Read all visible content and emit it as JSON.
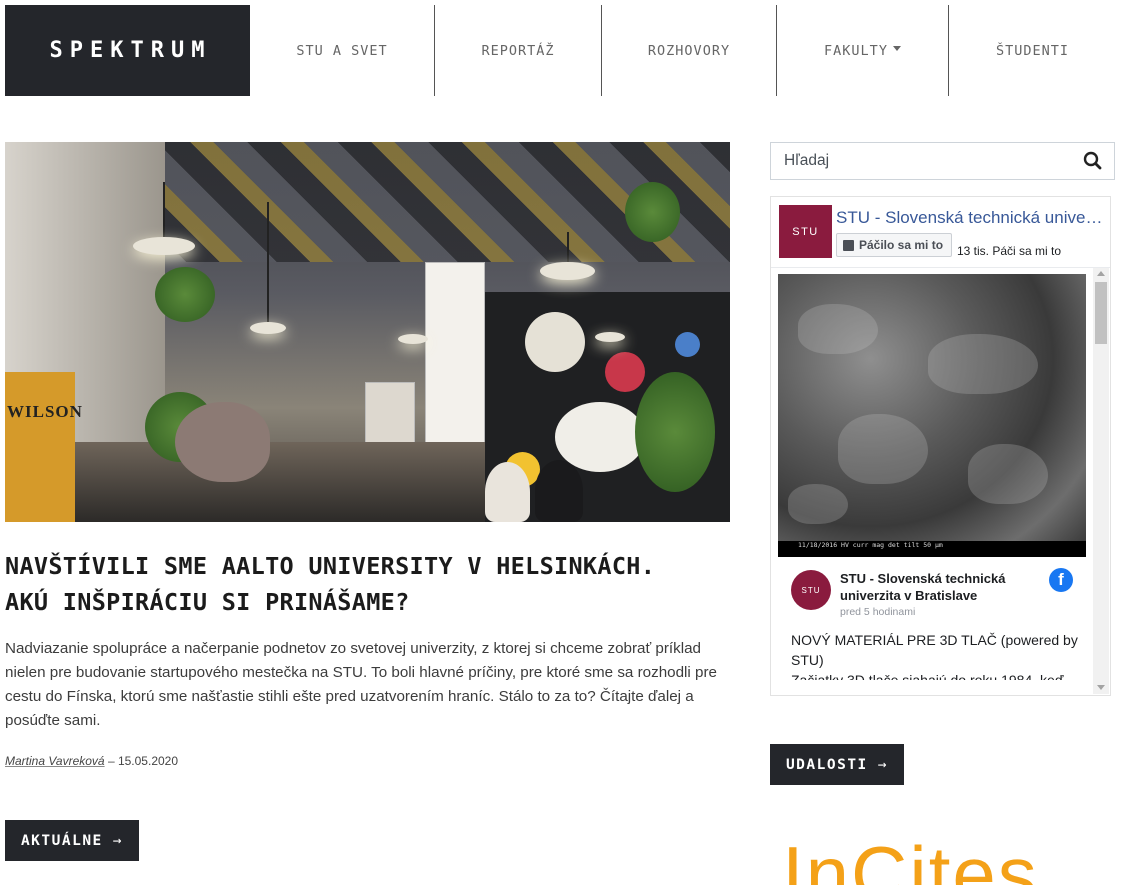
{
  "header": {
    "logo": "SPEKTRUM",
    "nav": [
      {
        "label": "STU A SVET",
        "dropdown": false
      },
      {
        "label": "REPORTÁŽ",
        "dropdown": false
      },
      {
        "label": "ROZHOVORY",
        "dropdown": false
      },
      {
        "label": "FAKULTY",
        "dropdown": true
      },
      {
        "label": "ŠTUDENTI",
        "dropdown": false
      }
    ]
  },
  "article": {
    "title_line1": "NAVŠTÍVILI SME AALTO UNIVERSITY V HELSINKÁCH.",
    "title_line2": "AKÚ INŠPIRÁCIU SI PRINÁŠAME?",
    "excerpt": "Nadviazanie spolupráce a načerpanie podnetov zo svetovej univerzity, z ktorej si chceme zobrať príklad nielen pre budovanie startupového mestečka na STU. To boli hlavné príčiny, pre ktoré sme sa rozhodli pre cestu do Fínska, ktorú sme našťastie stihli ešte pred uzatvorením hraníc. Stálo to za to? Čítajte ďalej a posúďte sami.",
    "author": "Martina Vavreková",
    "separator": " – ",
    "date": "15.05.2020",
    "image_bag_text": "WILSON"
  },
  "buttons": {
    "aktualne": "AKTUÁLNE",
    "udalosti": "UDALOSTI",
    "arrow": "→"
  },
  "search": {
    "placeholder": "Hľadaj"
  },
  "facebook": {
    "page_name": "STU - Slovenská technická univerzita v Bratislave",
    "logo_text": "STU",
    "like_label": "Páčilo sa mi to",
    "like_count": "13 tis. Páči sa mi to",
    "sem_caption": "11/18/2016   HV   curr   mag   det   tilt        50 µm",
    "post": {
      "author": "STU - Slovenská technická univerzita v Bratislave",
      "time": "pred 5 hodinami",
      "text": "NOVÝ MATERIÁL PRE 3D TLAČ (powered by STU)\nZačiatky 3D tlače siahajú do roku 1984, keď Charles W. Hull požiadal o patentovanie"
    }
  },
  "colors": {
    "dark": "#24262b",
    "stu_brand": "#8a1b3e",
    "facebook_blue": "#1877f2",
    "incites_orange": "#f4a118"
  },
  "partner_logo": "InCites"
}
